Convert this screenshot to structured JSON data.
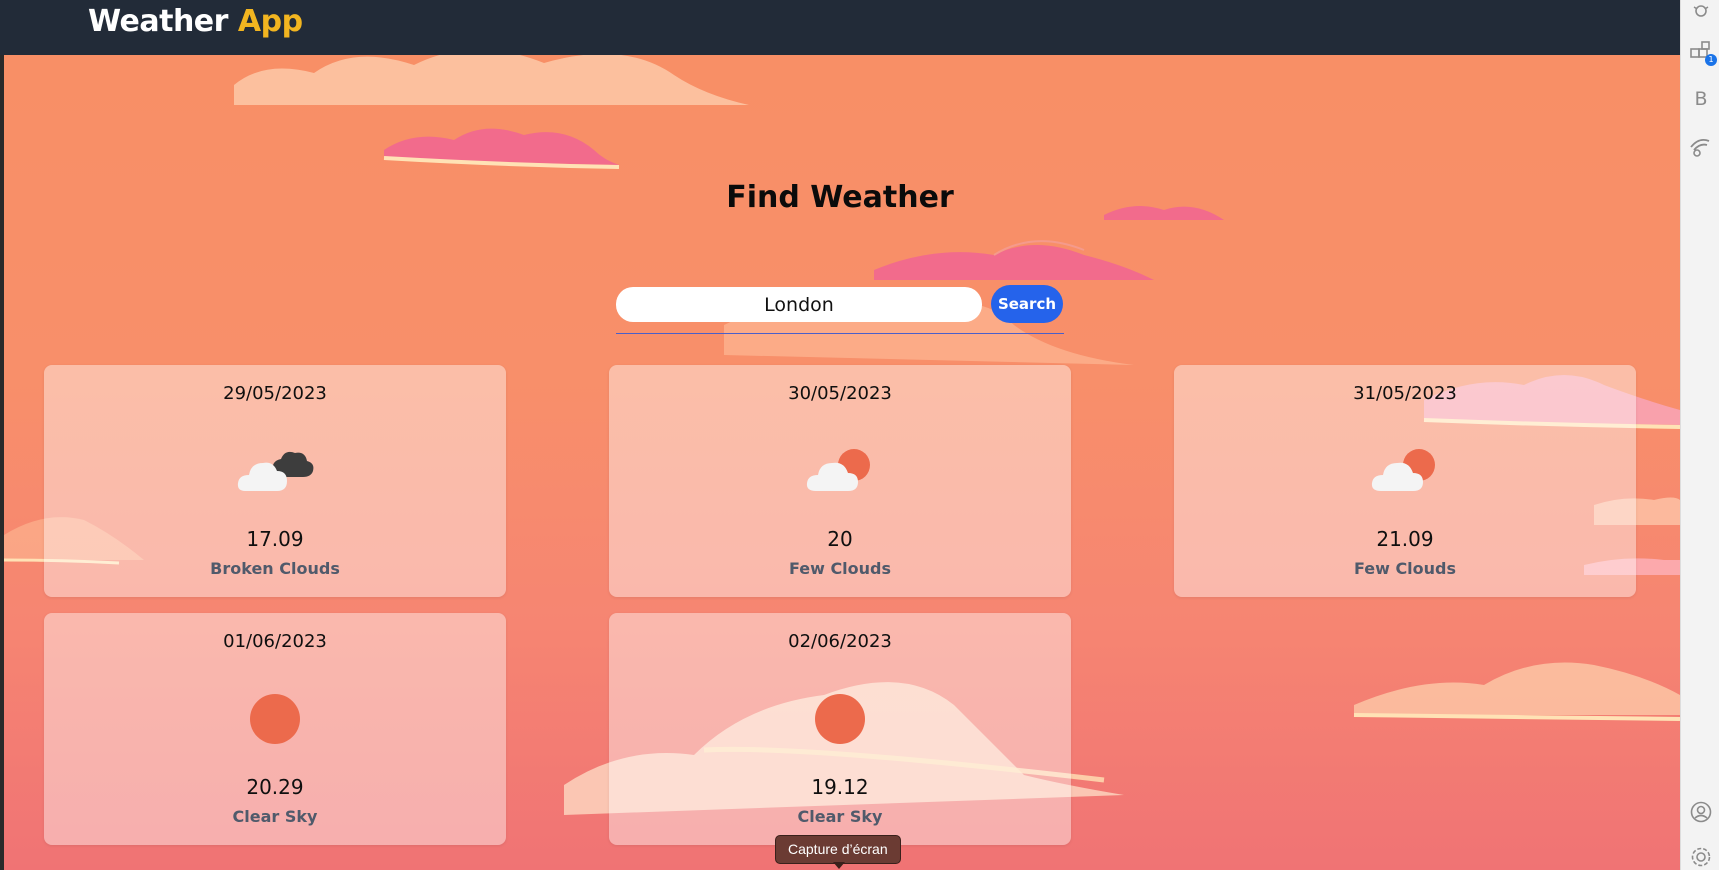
{
  "app": {
    "brand_main": "Weather",
    "brand_accent": "App",
    "accent_color": "#f2b520",
    "nav_bg": "#222b38"
  },
  "main": {
    "title": "Find Weather",
    "search": {
      "value": "London",
      "button_label": "Search",
      "button_color": "#2563eb"
    }
  },
  "forecast": [
    {
      "date": "29/05/2023",
      "icon": "broken-clouds-icon",
      "temp": "17.09",
      "desc": "Broken Clouds"
    },
    {
      "date": "30/05/2023",
      "icon": "few-clouds-icon",
      "temp": "20",
      "desc": "Few Clouds"
    },
    {
      "date": "31/05/2023",
      "icon": "few-clouds-icon",
      "temp": "21.09",
      "desc": "Few Clouds"
    },
    {
      "date": "01/06/2023",
      "icon": "clear-sky-icon",
      "temp": "20.29",
      "desc": "Clear Sky"
    },
    {
      "date": "02/06/2023",
      "icon": "clear-sky-icon",
      "temp": "19.12",
      "desc": "Clear Sky"
    }
  ],
  "sidebar": {
    "icons": [
      "bug-icon",
      "extensions-icon",
      "bold-b-icon",
      "cast-icon",
      "account-icon",
      "settings-icon"
    ],
    "badge": "1",
    "letter": "B"
  },
  "tooltip": {
    "text": "Capture d’écran"
  }
}
